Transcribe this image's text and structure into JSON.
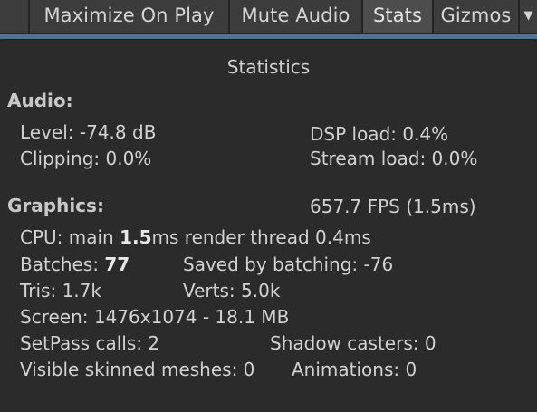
{
  "toolbar": {
    "maximize_on_play": "Maximize On Play",
    "mute_audio": "Mute Audio",
    "stats": "Stats",
    "gizmos": "Gizmos",
    "dropdown_arrow": "▼"
  },
  "stats": {
    "title": "Statistics",
    "audio": {
      "header": "Audio:",
      "level": "Level: -74.8 dB",
      "clipping": "Clipping: 0.0%",
      "dsp_load": "DSP load: 0.4%",
      "stream_load": "Stream load: 0.0%"
    },
    "graphics": {
      "header": "Graphics:",
      "fps": "657.7 FPS (1.5ms)",
      "cpu_prefix": "CPU: main ",
      "cpu_main": "1.5",
      "cpu_suffix": "ms  render thread 0.4ms",
      "batches_prefix": "Batches: ",
      "batches_value": "77",
      "saved_by_batching": "Saved by batching: -76",
      "tris": "Tris: 1.7k",
      "verts": "Verts: 5.0k",
      "screen": "Screen: 1476x1074 - 18.1 MB",
      "setpass_calls": "SetPass calls: 2",
      "shadow_casters": "Shadow casters: 0",
      "visible_skinned_meshes": "Visible skinned meshes: 0",
      "animations": "Animations: 0"
    }
  }
}
